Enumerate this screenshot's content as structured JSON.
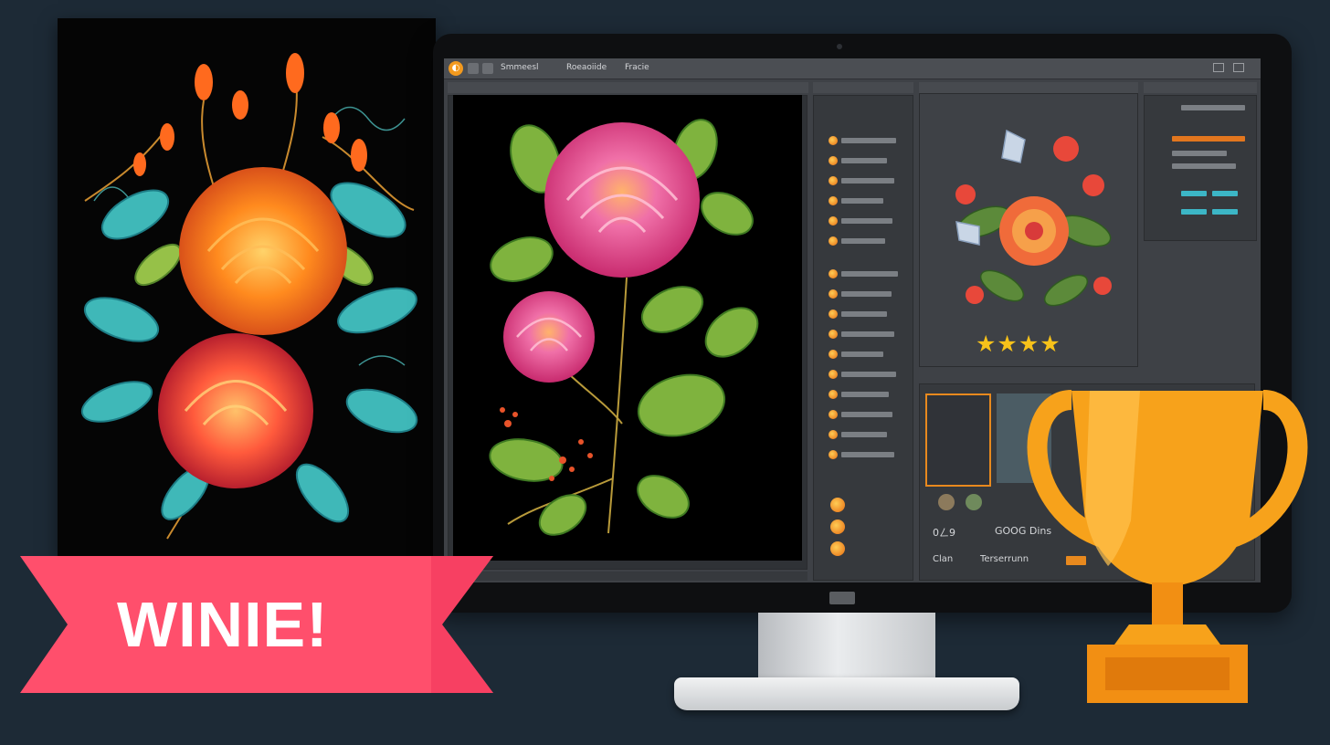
{
  "ribbon": {
    "text": "WINIE!",
    "color": "#ff4f6c"
  },
  "app": {
    "title_fragments": [
      "Smmeesl",
      "Roeaoiide",
      "Fracie"
    ],
    "status_fragments": [
      "0ㄥ9",
      "Clan",
      "GOOG Dins",
      "Terserrunn"
    ]
  },
  "rating": {
    "stars": "★★★★",
    "value": 4
  },
  "icons": [
    "app-logo-icon",
    "trophy-icon",
    "star-icon",
    "window-close-icon",
    "window-minimize-icon",
    "orange-layer-icon"
  ],
  "colors": {
    "accent": "#f39a1e",
    "trophy": "#f7a21b",
    "app_bg": "#3e4146",
    "page_bg": "#1d2a36"
  }
}
